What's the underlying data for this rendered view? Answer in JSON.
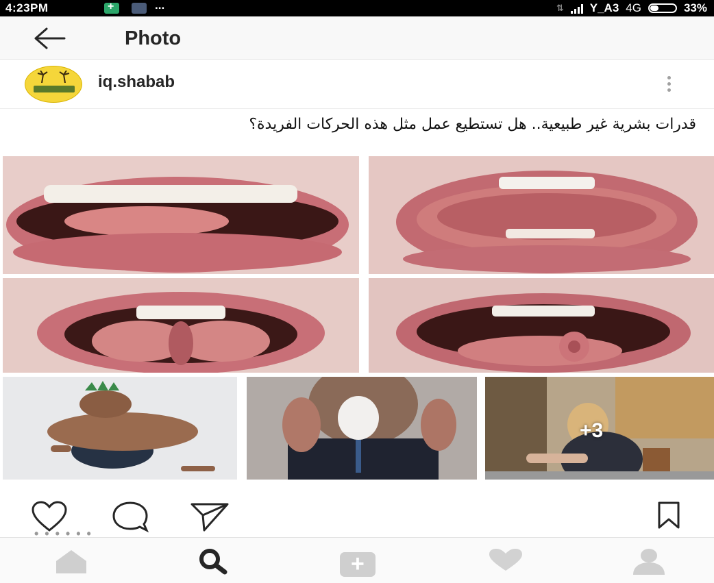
{
  "status_bar": {
    "time": "4:23PM",
    "dots": "...",
    "carrier": "Y_A3",
    "network": "4G",
    "battery": "33%"
  },
  "header": {
    "title": "Photo"
  },
  "post": {
    "username": "iq.shabab",
    "caption": "قدرات بشرية غير طبيعية.. هل تستطيع عمل مثل هذه الحركات الفريدة؟",
    "more_photos_badge": "+3",
    "images": [
      {
        "name": "tongue-folded-left",
        "description": "mouth with folded tongue"
      },
      {
        "name": "tongue-rolled-around",
        "description": "tongue rolled around teeth"
      },
      {
        "name": "tongue-split-fold",
        "description": "tongue folded in middle"
      },
      {
        "name": "tongue-cloverleaf",
        "description": "tongue curled cloverleaf"
      },
      {
        "name": "contortionist",
        "description": "contortionist with mohawk"
      },
      {
        "name": "egg-balance-man",
        "description": "man balancing egg"
      },
      {
        "name": "girl-twisted-arms",
        "description": "girl with twisted arms"
      }
    ]
  },
  "actions": {
    "icons": [
      "heart-icon",
      "comment-icon",
      "share-icon",
      "bookmark-icon"
    ]
  },
  "bottom_nav": {
    "icons": [
      "home-icon",
      "search-icon",
      "add-icon",
      "activity-icon",
      "profile-icon"
    ],
    "add_label": "+"
  },
  "colors": {
    "status_bg": "#000000",
    "header_bg": "#f8f8f8",
    "nav_bg": "#fafafa",
    "icon_dark": "#262626",
    "icon_inactive": "#cfcfcf"
  }
}
